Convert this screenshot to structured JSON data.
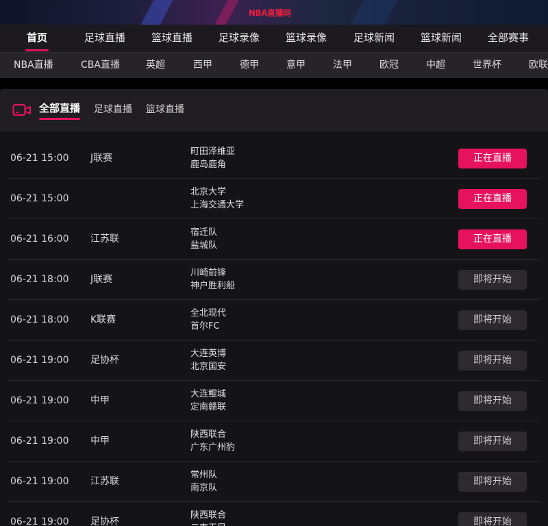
{
  "banner": {
    "logo": "NBA直播网"
  },
  "main_nav": [
    "首页",
    "足球直播",
    "篮球直播",
    "足球录像",
    "篮球录像",
    "足球新闻",
    "篮球新闻",
    "全部赛事"
  ],
  "sub_nav": [
    "NBA直播",
    "CBA直播",
    "英超",
    "西甲",
    "德甲",
    "意甲",
    "法甲",
    "欧冠",
    "中超",
    "世界杯",
    "欧联"
  ],
  "panel": {
    "icon": "video-camera-icon",
    "tabs": [
      "全部直播",
      "足球直播",
      "篮球直播"
    ],
    "active_tab": "全部直播"
  },
  "colors": {
    "accent": "#e6125d",
    "live_button": "#e6125d",
    "soon_button": "#2c2a2f"
  },
  "matches": [
    {
      "time": "06-21 15:00",
      "league": "J联赛",
      "home": "町田泽维亚",
      "away": "鹿岛鹿角",
      "status": "正在直播",
      "state": "live"
    },
    {
      "time": "06-21 15:00",
      "league": "",
      "home": "北京大学",
      "away": "上海交通大学",
      "status": "正在直播",
      "state": "live"
    },
    {
      "time": "06-21 16:00",
      "league": "江苏联",
      "home": "宿迁队",
      "away": "盐城队",
      "status": "正在直播",
      "state": "live"
    },
    {
      "time": "06-21 18:00",
      "league": "J联赛",
      "home": "川崎前锋",
      "away": "神户胜利船",
      "status": "即将开始",
      "state": "soon"
    },
    {
      "time": "06-21 18:00",
      "league": "K联赛",
      "home": "全北现代",
      "away": "首尔FC",
      "status": "即将开始",
      "state": "soon"
    },
    {
      "time": "06-21 19:00",
      "league": "足协杯",
      "home": "大连英博",
      "away": "北京国安",
      "status": "即将开始",
      "state": "soon"
    },
    {
      "time": "06-21 19:00",
      "league": "中甲",
      "home": "大连鲲城",
      "away": "定南赣联",
      "status": "即将开始",
      "state": "soon"
    },
    {
      "time": "06-21 19:00",
      "league": "中甲",
      "home": "陕西联合",
      "away": "广东广州豹",
      "status": "即将开始",
      "state": "soon"
    },
    {
      "time": "06-21 19:00",
      "league": "江苏联",
      "home": "常州队",
      "away": "南京队",
      "status": "即将开始",
      "state": "soon"
    },
    {
      "time": "06-21 19:00",
      "league": "足协杯",
      "home": "陕西联合",
      "away": "云南玉昆",
      "status": "即将开始",
      "state": "soon"
    }
  ]
}
